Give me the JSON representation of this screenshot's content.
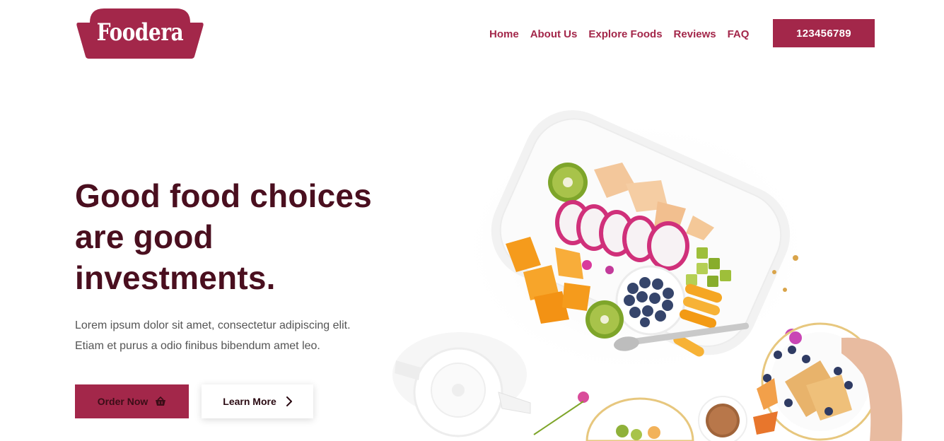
{
  "brand": {
    "name": "Foodera"
  },
  "nav": {
    "items": [
      {
        "label": "Home"
      },
      {
        "label": "About Us"
      },
      {
        "label": "Explore Foods"
      },
      {
        "label": "Reviews"
      },
      {
        "label": "FAQ"
      }
    ],
    "phone": "123456789"
  },
  "hero": {
    "headline_1": "Good food choices",
    "headline_2": "are good",
    "headline_3": "investments.",
    "paragraph_1": "Lorem ipsum dolor sit amet, consectetur adipiscing elit.",
    "paragraph_2": "Etiam et purus a odio finibus bibendum amet leo.",
    "order_label": "Order Now",
    "order_icon": "basket-icon",
    "learn_label": "Learn More",
    "learn_icon": "chevron-right-icon"
  },
  "colors": {
    "brand": "#a3274a",
    "headline": "#4a0f1f",
    "body_text": "#555555"
  }
}
